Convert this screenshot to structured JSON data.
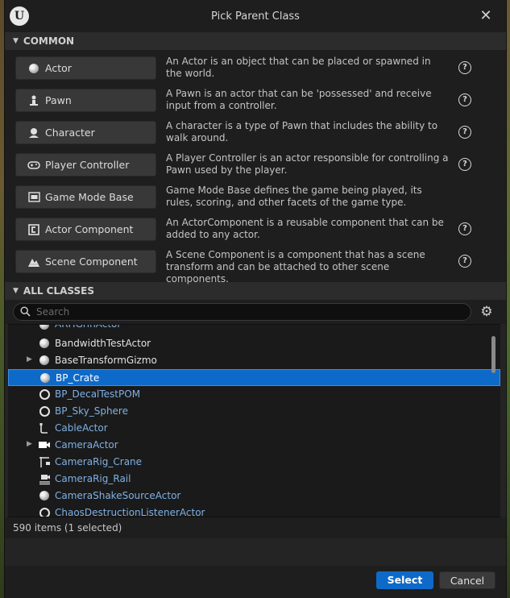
{
  "window": {
    "title": "Pick Parent Class",
    "logo_text": "U"
  },
  "common": {
    "header": "COMMON",
    "items": [
      {
        "label": "Actor",
        "icon": "actor-sphere-icon",
        "description": "An Actor is an object that can be placed or spawned in the world.",
        "has_help": true
      },
      {
        "label": "Pawn",
        "icon": "pawn-icon",
        "description": "A Pawn is an actor that can be 'possessed' and receive input from a controller.",
        "has_help": true
      },
      {
        "label": "Character",
        "icon": "character-icon",
        "description": "A character is a type of Pawn that includes the ability to walk around.",
        "has_help": true
      },
      {
        "label": "Player Controller",
        "icon": "gamepad-icon",
        "description": "A Player Controller is an actor responsible for controlling a Pawn used by the player.",
        "has_help": true
      },
      {
        "label": "Game Mode Base",
        "icon": "game-mode-icon",
        "description": "Game Mode Base defines the game being played, its rules, scoring, and other facets of the game type.",
        "has_help": false
      },
      {
        "label": "Actor Component",
        "icon": "component-icon",
        "description": "An ActorComponent is a reusable component that can be added to any actor.",
        "has_help": true
      },
      {
        "label": "Scene Component",
        "icon": "scene-component-icon",
        "description": "A Scene Component is a component that has a scene transform and can be attached to other scene components.",
        "has_help": true
      }
    ]
  },
  "all_classes": {
    "header": "ALL CLASSES",
    "search_placeholder": "Search",
    "items": [
      {
        "label": "ARHGrinActor",
        "icon": "actor-sphere-icon",
        "style": "blue",
        "expandable": false,
        "partial": true
      },
      {
        "label": "BandwidthTestActor",
        "icon": "actor-sphere-icon",
        "style": "white",
        "expandable": false
      },
      {
        "label": "BaseTransformGizmo",
        "icon": "actor-sphere-icon",
        "style": "white",
        "expandable": true
      },
      {
        "label": "BP_Crate",
        "icon": "actor-sphere-icon",
        "style": "blue",
        "expandable": false,
        "selected": true
      },
      {
        "label": "BP_DecalTestPOM",
        "icon": "ring-icon",
        "style": "blue",
        "expandable": false
      },
      {
        "label": "BP_Sky_Sphere",
        "icon": "ring-icon",
        "style": "blue",
        "expandable": false
      },
      {
        "label": "CableActor",
        "icon": "cable-icon",
        "style": "blue",
        "expandable": false
      },
      {
        "label": "CameraActor",
        "icon": "camera-icon",
        "style": "blue",
        "expandable": true
      },
      {
        "label": "CameraRig_Crane",
        "icon": "crane-icon",
        "style": "blue",
        "expandable": false
      },
      {
        "label": "CameraRig_Rail",
        "icon": "rail-icon",
        "style": "blue",
        "expandable": false
      },
      {
        "label": "CameraShakeSourceActor",
        "icon": "actor-sphere-icon",
        "style": "blue",
        "expandable": false
      },
      {
        "label": "ChaosDestructionListenerActor",
        "icon": "ring-icon",
        "style": "blue",
        "expandable": false
      }
    ],
    "count_text": "590 items (1 selected)"
  },
  "footer": {
    "select_label": "Select",
    "cancel_label": "Cancel"
  }
}
